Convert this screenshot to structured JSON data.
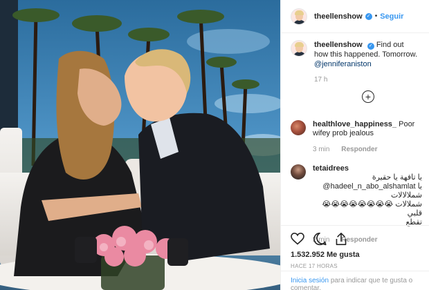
{
  "post": {
    "username": "theellenshow",
    "verified": true,
    "follow_label": "Seguir",
    "separator": "•",
    "caption_text": "Find out how this happened. Tomorrow.",
    "caption_mention": "@jenniferaniston",
    "time_ago": "17 h",
    "load_more_icon": "plus-circle-icon"
  },
  "comments": [
    {
      "username": "healthlove_happiness_",
      "text": "Poor wifey prob jealous",
      "time": "3 min",
      "reply_label": "Responder"
    },
    {
      "username": "tetaidrees",
      "text_line1": "يا تافهة يا حقيرة",
      "text_line2": "@hadeel_n_abo_alshamlat يا شملالالات",
      "text_line3": "شملالات 😭😭😭😭😭😭😭😭 قلبي",
      "text_line4": "تقطع",
      "time": "2 min",
      "reply_label": "Responder"
    }
  ],
  "actions": {
    "icons": [
      "heart-icon",
      "comment-icon",
      "share-icon"
    ],
    "likes": "1.532.952 Me gusta",
    "posted": "HACE 17 HORAS"
  },
  "footer": {
    "login_link": "Inicia sesión",
    "login_text": "para indicar que te gusta o comentar."
  },
  "colors": {
    "accent": "#3897f0",
    "verified": "#3897f0",
    "muted": "#999999",
    "text": "#262626"
  }
}
